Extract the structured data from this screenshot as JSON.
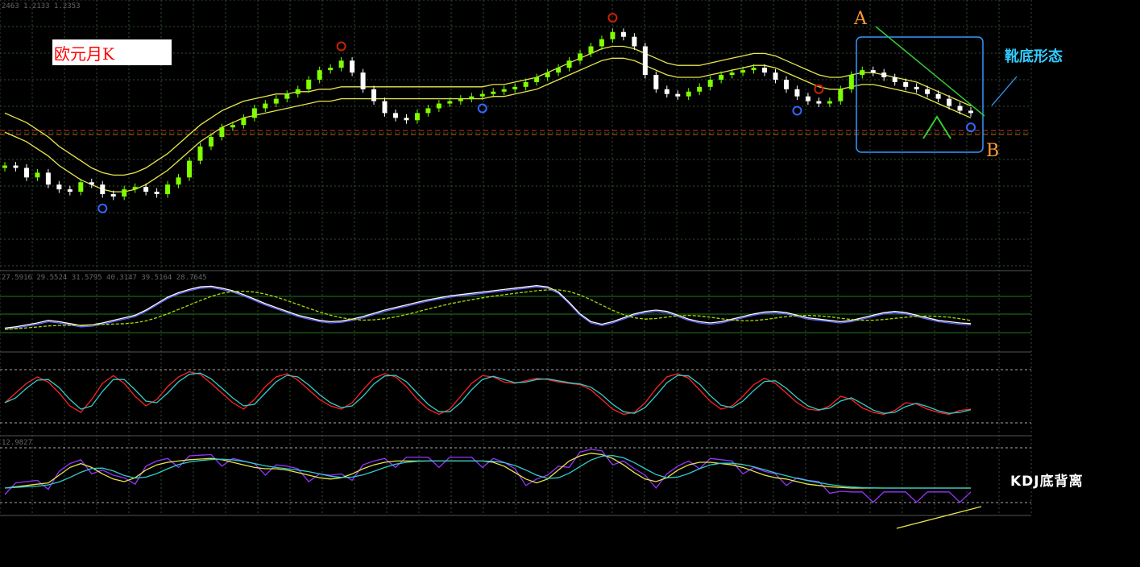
{
  "window": {
    "price_readout": "2463 1.2133 1.2353",
    "indicator1_readout": "27.5916 29.5524 31.5795 40.3147 39.5164 28.7645",
    "indicator3_readout": "12.9827"
  },
  "annotations": {
    "title": "欧元月K",
    "label_a": "A",
    "label_b": "B",
    "pattern": "靴底形态",
    "divergence": "KDJ底背离"
  },
  "colors": {
    "background": "#000000",
    "grid": "#2f4f2f",
    "up_candle": "#7fff00",
    "down_candle": "#ffffff",
    "bollinger": "#e6e64d",
    "price_level": "#cc3333",
    "box": "#3399ff",
    "trend_line": "#33cc33",
    "fractal_up": "#cc2200",
    "fractal_down": "#3366ff",
    "osc_white": "#ffffff",
    "osc_blue": "#6666ff",
    "osc_green_dashed": "#aadd00",
    "osc_red": "#ff2222",
    "osc_cyan": "#33cccc",
    "osc_purple": "#9933ff",
    "osc_yellow": "#e6e64d"
  },
  "chart_data": {
    "type": "candlestick",
    "title": "欧元月K",
    "y_range": [
      0,
      100
    ],
    "price_closes": [
      38,
      37,
      33,
      35,
      30,
      28,
      27,
      31,
      30,
      26,
      25,
      28,
      29,
      27,
      26,
      30,
      33,
      40,
      46,
      50,
      54,
      55,
      58,
      62,
      64,
      66,
      68,
      70,
      74,
      78,
      79,
      82,
      77,
      70,
      65,
      60,
      58,
      57,
      60,
      62,
      64,
      65,
      66,
      67,
      68,
      69,
      70,
      71,
      73,
      75,
      77,
      79,
      82,
      85,
      88,
      91,
      94,
      92,
      88,
      76,
      70,
      68,
      67,
      69,
      71,
      74,
      76,
      77,
      78,
      79,
      77,
      74,
      70,
      67,
      65,
      64,
      65,
      70,
      76,
      78,
      77,
      75,
      73,
      71,
      70,
      68,
      66,
      63,
      61,
      60
    ],
    "bollinger_upper": [
      60,
      58,
      56,
      53,
      50,
      46,
      43,
      40,
      37,
      35,
      34,
      34,
      35,
      37,
      40,
      43,
      47,
      51,
      55,
      58,
      61,
      63,
      65,
      66,
      67,
      68,
      68,
      69,
      69,
      70,
      70,
      71,
      71,
      71,
      71,
      71,
      71,
      71,
      71,
      71,
      71,
      71,
      71,
      71,
      71,
      72,
      72,
      73,
      74,
      75,
      77,
      79,
      81,
      83,
      85,
      87,
      88,
      88,
      87,
      85,
      83,
      81,
      80,
      80,
      80,
      81,
      82,
      83,
      84,
      85,
      85,
      84,
      82,
      80,
      78,
      76,
      75,
      75,
      76,
      77,
      77,
      76,
      75,
      74,
      73,
      71,
      69,
      67,
      65,
      63
    ],
    "bollinger_lower": [
      52,
      50,
      48,
      45,
      42,
      38,
      35,
      32,
      30,
      28,
      27,
      27,
      28,
      30,
      33,
      36,
      40,
      44,
      48,
      51,
      54,
      56,
      58,
      59,
      60,
      61,
      62,
      63,
      64,
      65,
      65,
      66,
      66,
      66,
      66,
      66,
      66,
      66,
      66,
      66,
      66,
      66,
      66,
      66,
      66,
      67,
      67,
      68,
      69,
      70,
      72,
      74,
      76,
      78,
      80,
      82,
      83,
      83,
      82,
      80,
      78,
      76,
      75,
      75,
      75,
      76,
      77,
      78,
      79,
      80,
      80,
      79,
      77,
      75,
      73,
      71,
      70,
      70,
      71,
      72,
      72,
      71,
      70,
      69,
      68,
      66,
      64,
      62,
      60,
      58
    ],
    "oscillator_1": [
      20,
      22,
      25,
      28,
      32,
      30,
      27,
      24,
      25,
      28,
      32,
      36,
      40,
      48,
      58,
      68,
      75,
      80,
      84,
      85,
      82,
      78,
      72,
      65,
      58,
      52,
      46,
      40,
      36,
      32,
      30,
      31,
      34,
      38,
      43,
      48,
      52,
      56,
      60,
      64,
      67,
      70,
      72,
      74,
      76,
      78,
      80,
      82,
      84,
      86,
      84,
      76,
      60,
      42,
      30,
      26,
      30,
      36,
      42,
      46,
      48,
      46,
      40,
      34,
      30,
      28,
      30,
      34,
      38,
      42,
      45,
      46,
      44,
      40,
      36,
      34,
      32,
      30,
      32,
      36,
      40,
      44,
      46,
      44,
      40,
      36,
      32,
      30,
      28,
      27
    ],
    "oscillator_2": [
      40,
      55,
      70,
      80,
      72,
      55,
      35,
      25,
      45,
      70,
      82,
      70,
      50,
      35,
      45,
      65,
      80,
      88,
      84,
      70,
      55,
      40,
      30,
      45,
      65,
      80,
      85,
      75,
      60,
      45,
      35,
      30,
      40,
      60,
      78,
      85,
      80,
      65,
      45,
      30,
      22,
      30,
      50,
      70,
      82,
      80,
      72,
      70,
      74,
      78,
      76,
      72,
      70,
      68,
      60,
      45,
      30,
      22,
      25,
      40,
      62,
      80,
      85,
      78,
      60,
      42,
      30,
      35,
      50,
      68,
      78,
      70,
      55,
      40,
      30,
      28,
      35,
      50,
      45,
      32,
      25,
      22,
      28,
      40,
      38,
      30,
      25,
      22,
      28,
      30
    ],
    "oscillator_3": [
      30,
      32,
      34,
      36,
      38,
      50,
      62,
      68,
      62,
      52,
      44,
      40,
      46,
      58,
      66,
      70,
      72,
      74,
      75,
      76,
      74,
      70,
      66,
      62,
      60,
      60,
      58,
      54,
      50,
      46,
      44,
      46,
      52,
      60,
      66,
      70,
      72,
      72,
      72,
      72,
      72,
      72,
      72,
      72,
      72,
      70,
      64,
      54,
      44,
      38,
      44,
      58,
      72,
      80,
      84,
      82,
      76,
      66,
      54,
      44,
      40,
      46,
      58,
      66,
      70,
      70,
      68,
      66,
      62,
      56,
      50,
      46,
      44,
      40,
      36,
      34,
      32,
      31,
      30,
      30,
      30,
      30,
      30,
      30,
      30,
      30,
      30,
      30,
      30,
      30
    ]
  }
}
